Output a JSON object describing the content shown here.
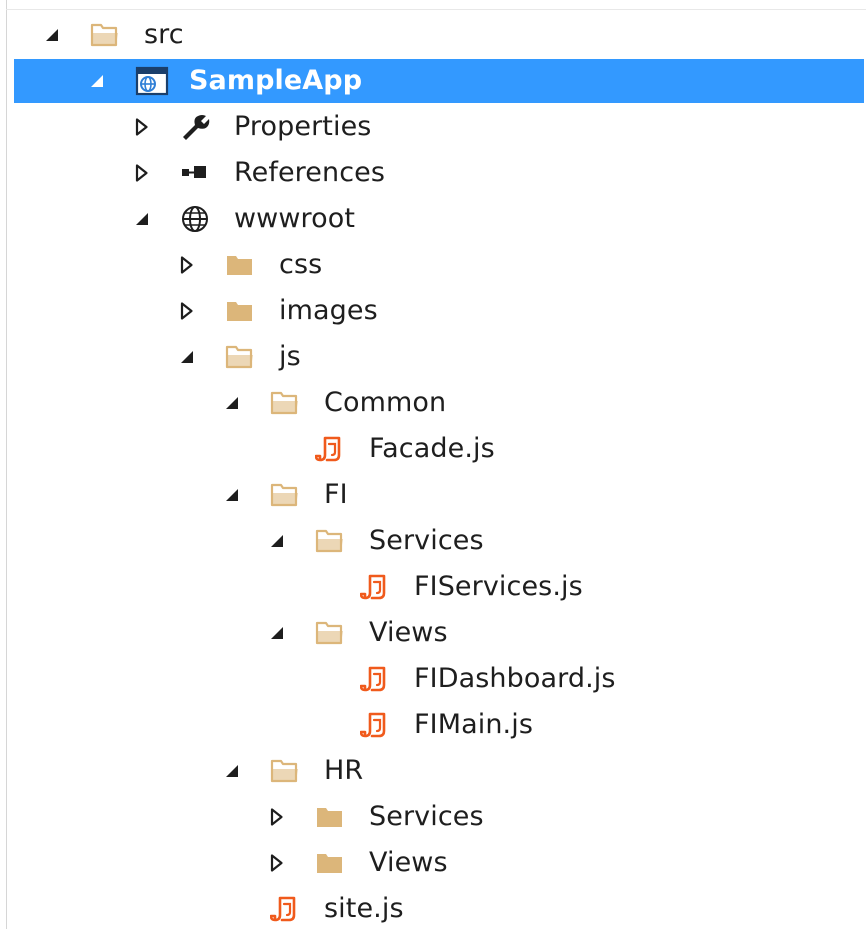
{
  "colors": {
    "selection": "#3399ff",
    "folder": "#dcb67a",
    "js_file": "#f05a1c",
    "glyph": "#1e1e1e"
  },
  "tree": {
    "items": [
      {
        "label": "src",
        "depth": 0,
        "expander": "expanded",
        "icon": "folder-open-icon"
      },
      {
        "label": "SampleApp",
        "depth": 1,
        "expander": "expanded",
        "icon": "web-project-icon",
        "selected": true
      },
      {
        "label": "Properties",
        "depth": 2,
        "expander": "collapsed",
        "icon": "wrench-icon"
      },
      {
        "label": "References",
        "depth": 2,
        "expander": "collapsed",
        "icon": "references-icon"
      },
      {
        "label": "wwwroot",
        "depth": 2,
        "expander": "expanded",
        "icon": "globe-icon"
      },
      {
        "label": "css",
        "depth": 3,
        "expander": "collapsed",
        "icon": "folder-closed-icon"
      },
      {
        "label": "images",
        "depth": 3,
        "expander": "collapsed",
        "icon": "folder-closed-icon"
      },
      {
        "label": "js",
        "depth": 3,
        "expander": "expanded",
        "icon": "folder-open-icon"
      },
      {
        "label": "Common",
        "depth": 4,
        "expander": "expanded",
        "icon": "folder-open-icon"
      },
      {
        "label": "Facade.js",
        "depth": 5,
        "expander": "none",
        "icon": "js-file-icon"
      },
      {
        "label": "FI",
        "depth": 4,
        "expander": "expanded",
        "icon": "folder-open-icon"
      },
      {
        "label": "Services",
        "depth": 5,
        "expander": "expanded",
        "icon": "folder-open-icon"
      },
      {
        "label": "FIServices.js",
        "depth": 6,
        "expander": "none",
        "icon": "js-file-icon"
      },
      {
        "label": "Views",
        "depth": 5,
        "expander": "expanded",
        "icon": "folder-open-icon"
      },
      {
        "label": "FIDashboard.js",
        "depth": 6,
        "expander": "none",
        "icon": "js-file-icon"
      },
      {
        "label": "FIMain.js",
        "depth": 6,
        "expander": "none",
        "icon": "js-file-icon"
      },
      {
        "label": "HR",
        "depth": 4,
        "expander": "expanded",
        "icon": "folder-open-icon"
      },
      {
        "label": "Services",
        "depth": 5,
        "expander": "collapsed",
        "icon": "folder-closed-icon"
      },
      {
        "label": "Views",
        "depth": 5,
        "expander": "collapsed",
        "icon": "folder-closed-icon"
      },
      {
        "label": "site.js",
        "depth": 4,
        "expander": "none",
        "icon": "js-file-icon"
      }
    ]
  }
}
